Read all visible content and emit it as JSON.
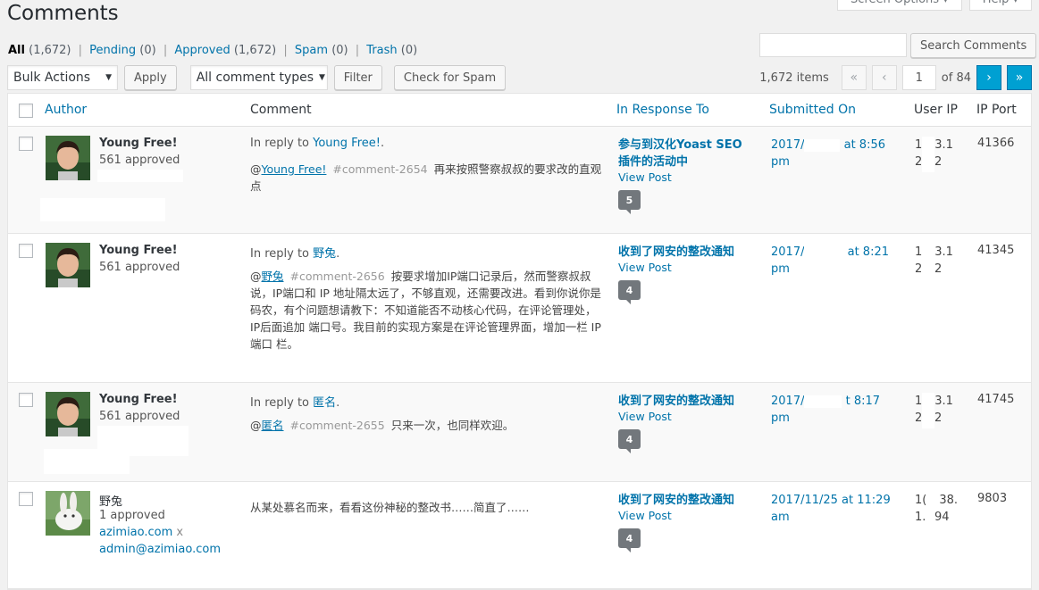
{
  "page_title": "Comments",
  "top_tabs": [
    "Screen Options ▾",
    "Help ▾"
  ],
  "filters": [
    {
      "label": "All",
      "count": "(1,672)",
      "current": true
    },
    {
      "label": "Pending",
      "count": "(0)"
    },
    {
      "label": "Approved",
      "count": "(1,672)"
    },
    {
      "label": "Spam",
      "count": "(0)"
    },
    {
      "label": "Trash",
      "count": "(0)"
    }
  ],
  "search": {
    "value": "",
    "button": "Search Comments"
  },
  "toolbar": {
    "bulk_actions": "Bulk Actions",
    "apply": "Apply",
    "comment_types": "All comment types",
    "filter": "Filter",
    "check_spam": "Check for Spam"
  },
  "pagination": {
    "items": "1,672 items",
    "first": "«",
    "prev": "‹",
    "current_page": "1",
    "of_pages": "of 84",
    "next": "›",
    "last": "»"
  },
  "columns": {
    "author": "Author",
    "comment": "Comment",
    "in_response_to": "In Response To",
    "submitted_on": "Submitted On",
    "user_ip": "User IP",
    "ip_port": "IP Port"
  },
  "rows": [
    {
      "author": "Young Free!",
      "approved": "561 approved",
      "reply_prefix": "In reply to ",
      "reply_to": "Young Free!",
      "reply_suffix": ".",
      "mention": "Young Free!",
      "anchor": "#comment-2654",
      "text": "再来按照警察叔叔的要求改的直观点",
      "post_title": "参与到汉化Yoast SEO插件的活动中",
      "view_post": "View Post",
      "comment_count": "5",
      "date1": "2017/",
      "date2": "at 8:56",
      "date3": "pm",
      "ip1": "1",
      "ip2": "3.1",
      "ip3": "2",
      "ip4": "2",
      "port": "41366"
    },
    {
      "author": "Young Free!",
      "approved": "561 approved",
      "reply_prefix": "In reply to ",
      "reply_to": "野兔",
      "reply_suffix": ".",
      "mention": "野兔",
      "anchor": "#comment-2656",
      "text": "按要求增加IP端口记录后，然而警察叔叔说，IP端口和 IP 地址隔太远了，不够直观，还需要改进。看到你说你是码农，有个问题想请教下：不知道能否不动核心代码，在评论管理处，IP后面追加 端口号。我目前的实现方案是在评论管理界面，增加一栏 IP 端口 栏。",
      "post_title": "收到了网安的整改通知",
      "view_post": "View Post",
      "comment_count": "4",
      "date1": "2017/",
      "date2": "at 8:21",
      "date3": "pm",
      "ip1": "1",
      "ip2": "3.1",
      "ip3": "2",
      "ip4": "2",
      "port": "41345"
    },
    {
      "author": "Young Free!",
      "approved": "561 approved",
      "reply_prefix": "In reply to ",
      "reply_to": "匿名",
      "reply_suffix": ".",
      "mention": "匿名",
      "anchor": "#comment-2655",
      "text": "只来一次，也同样欢迎。",
      "post_title": "收到了网安的整改通知",
      "view_post": "View Post",
      "comment_count": "4",
      "date1": "2017/",
      "date2": "t 8:17",
      "date3": "pm",
      "ip1": "1",
      "ip2": "3.1",
      "ip3": "2",
      "ip4": "2",
      "port": "41745"
    },
    {
      "author": "野兔",
      "approved": "1 approved",
      "site": "azimiao.com",
      "site_x": "x",
      "email": "admin@azimiao.com",
      "text": "从某处慕名而来，看看这份神秘的整改书……简直了……",
      "post_title": "收到了网安的整改通知",
      "view_post": "View Post",
      "comment_count": "4",
      "date1": "2017/11/25 at 11:29",
      "date3": "am",
      "ip1": "1(",
      "ip2": "38.",
      "ip3": "1.",
      "ip4": "94",
      "port": "9803"
    }
  ],
  "colors": {
    "link": "#0073aa",
    "bubble": "#72777c",
    "active_btn": "#00a0d2"
  }
}
